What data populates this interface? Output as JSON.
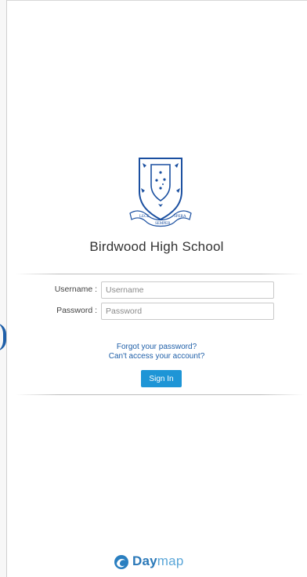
{
  "school": {
    "name": "Birdwood High School",
    "crest_motto": [
      "LEGE",
      "SEMPER",
      "SPERA"
    ]
  },
  "login": {
    "username_label": "Username :",
    "username_placeholder": "Username",
    "password_label": "Password :",
    "password_placeholder": "Password",
    "forgot_link": "Forgot your password?",
    "cant_access_link": "Can't access your account?",
    "signin_label": "Sign In"
  },
  "footer": {
    "logo_bold": "Day",
    "logo_light": "map",
    "logo_icon": "daymap-swirl-icon"
  },
  "colors": {
    "accent": "#1e95d6",
    "link": "#1f5fa8",
    "crest_blue": "#1a4fa0"
  }
}
